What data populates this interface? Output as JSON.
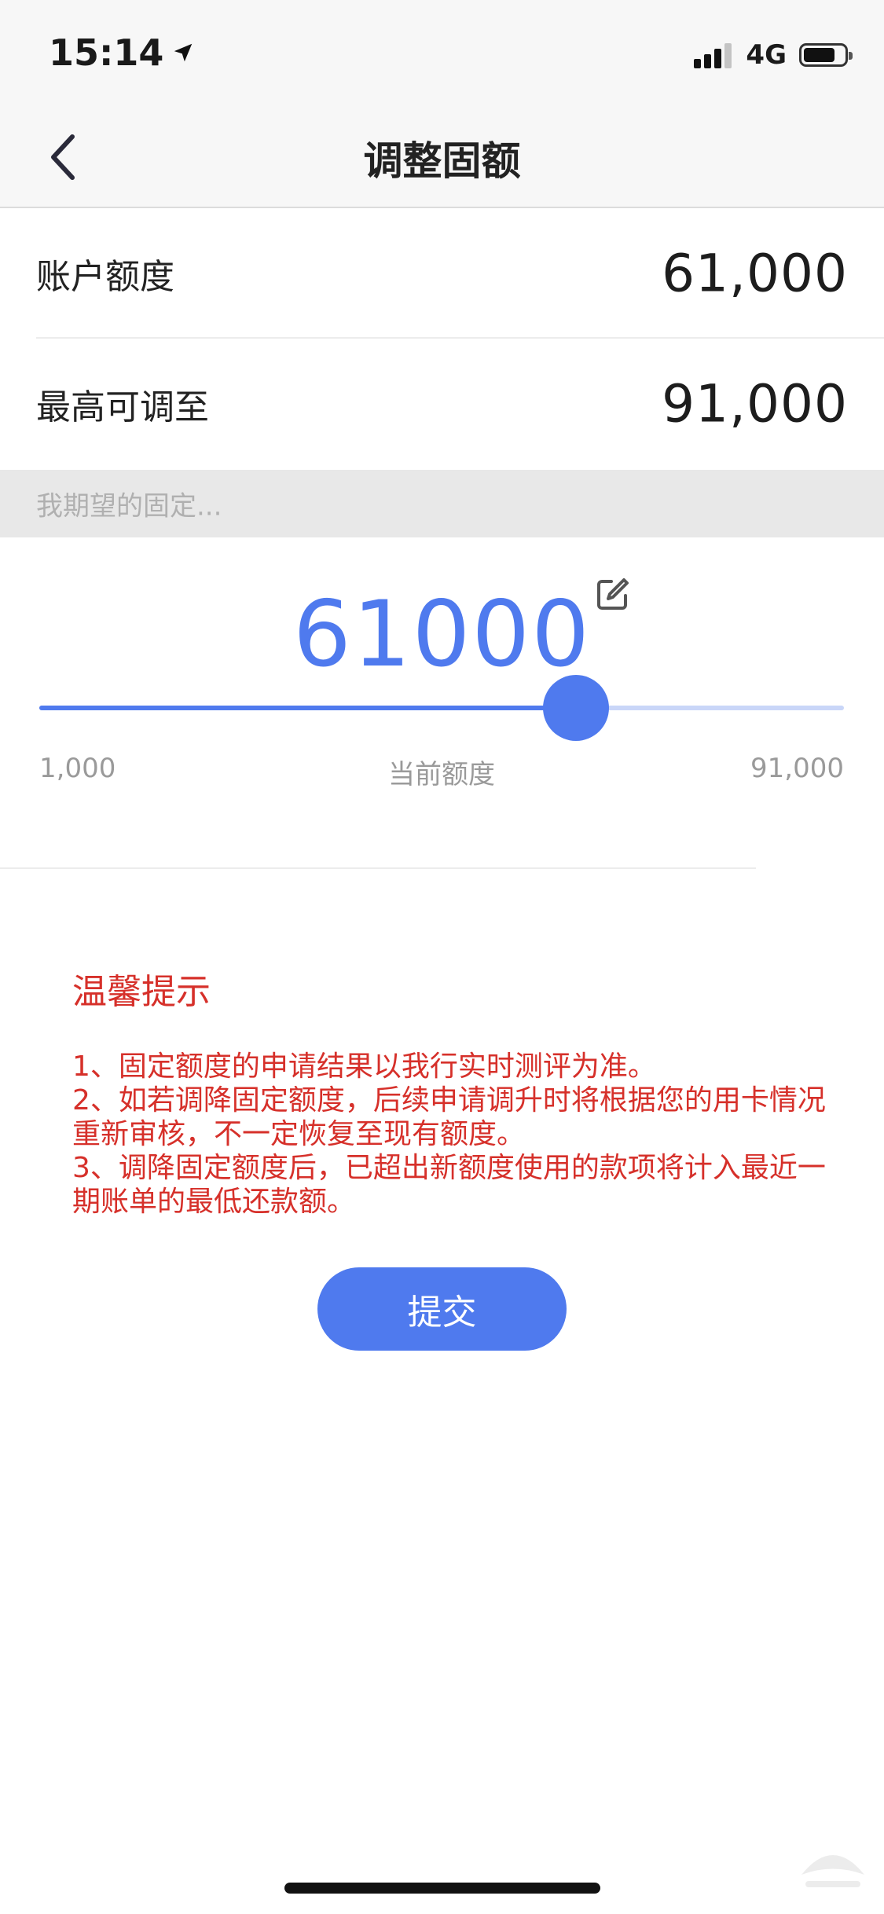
{
  "status_bar": {
    "time": "15:14",
    "network": "4G",
    "battery_level": 0.78,
    "signal_bars": 3,
    "signal_max": 4
  },
  "nav": {
    "title": "调整固额"
  },
  "account": {
    "limit_label": "账户额度",
    "limit_value": "61,000",
    "max_label": "最高可调至",
    "max_value": "91,000"
  },
  "expected": {
    "section_label": "我期望的固定..."
  },
  "slider": {
    "current_amount": "61000",
    "min": 1000,
    "max": 91000,
    "value": 61000,
    "min_label": "1,000",
    "mid_label": "当前额度",
    "max_label": "91,000"
  },
  "tips": {
    "title": "温馨提示",
    "items": [
      "1、固定额度的申请结果以我行实时测评为准。",
      "2、如若调降固定额度，后续申请调升时将根据您的用卡情况重新审核，不一定恢复至现有额度。",
      "3、调降固定额度后，已超出新额度使用的款项将计入最近一期账单的最低还款额。"
    ]
  },
  "actions": {
    "submit_label": "提交"
  },
  "colors": {
    "accent": "#4f7aee",
    "accent_light": "#c9d6f8",
    "warning_text": "#d6302a",
    "header_bg": "#f7f7f7",
    "section_bg": "#e8e8e8"
  },
  "icons": {
    "location": "location-arrow-icon",
    "signal": "cellular-signal-icon",
    "battery": "battery-icon",
    "back": "chevron-left-icon",
    "edit": "edit-icon"
  }
}
